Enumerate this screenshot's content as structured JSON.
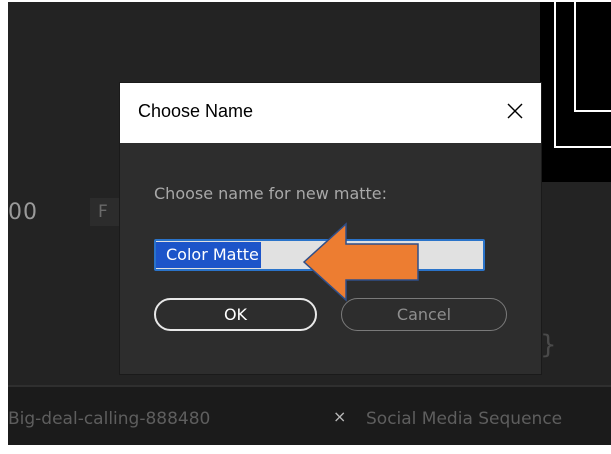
{
  "background": {
    "timecode_partial": "00",
    "fit_dropdown_partial": "F",
    "bracket_glyph": "}"
  },
  "bottom_tabs": {
    "left_tab_label": "Big-deal-calling-888480",
    "close_glyph": "×",
    "right_tab_label": "Social Media Sequence"
  },
  "dialog": {
    "title": "Choose Name",
    "close_icon": "close-icon",
    "prompt": "Choose name for new matte:",
    "input_value": "Color Matte",
    "ok_label": "OK",
    "cancel_label": "Cancel"
  },
  "annotation": {
    "arrow_icon": "arrow-left-icon",
    "arrow_color": "#ed7d31"
  },
  "colors": {
    "app_background": "#1f1f1f",
    "dialog_background": "#2d2d2d",
    "selection_highlight": "#1c54c9",
    "input_border": "#2a73c9"
  }
}
